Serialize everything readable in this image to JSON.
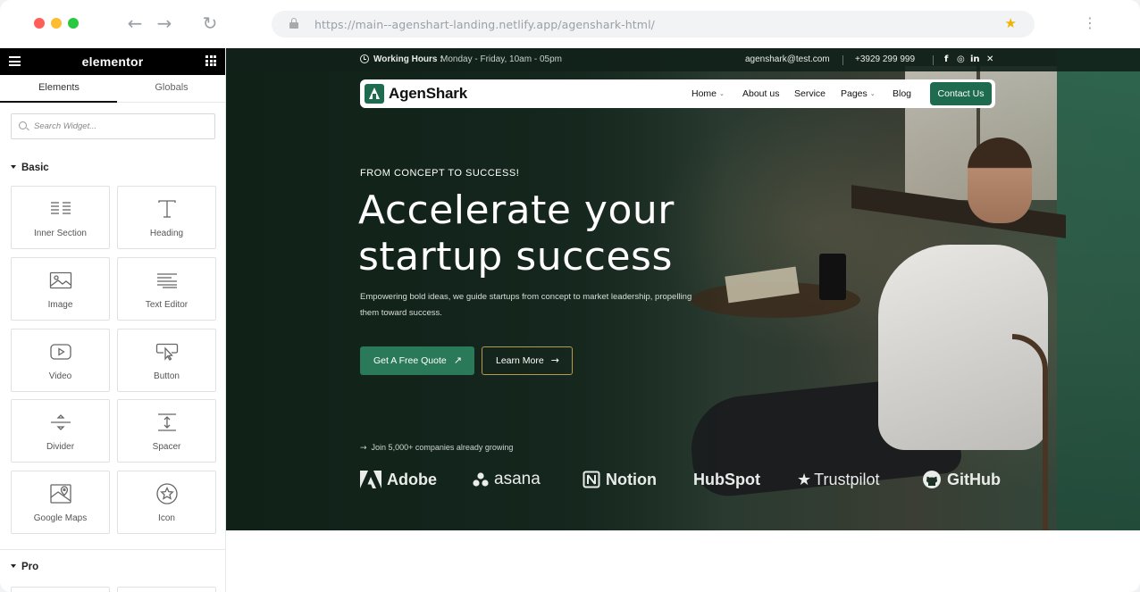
{
  "browser": {
    "url": "https://main--agenshart-landing.netlify.app/agenshark-html/",
    "icons": [
      "back-arrow-icon",
      "forward-arrow-icon",
      "reload-icon",
      "lock-icon",
      "bookmark-star-icon",
      "kebab-menu-icon"
    ]
  },
  "sidebar": {
    "logo": "elementor",
    "tabs": [
      {
        "label": "Elements"
      },
      {
        "label": "Globals"
      }
    ],
    "search_placeholder": "Search Widget...",
    "categories": [
      {
        "label": "Basic"
      },
      {
        "label": "Pro"
      }
    ],
    "widgets": [
      {
        "label": "Inner Section",
        "icon": "inner-section-icon"
      },
      {
        "label": "Heading",
        "icon": "heading-icon"
      },
      {
        "label": "Image",
        "icon": "image-icon"
      },
      {
        "label": "Text Editor",
        "icon": "text-editor-icon"
      },
      {
        "label": "Video",
        "icon": "video-icon"
      },
      {
        "label": "Button",
        "icon": "button-icon"
      },
      {
        "label": "Divider",
        "icon": "divider-icon"
      },
      {
        "label": "Spacer",
        "icon": "spacer-icon"
      },
      {
        "label": "Google Maps",
        "icon": "google-maps-icon"
      },
      {
        "label": "Icon",
        "icon": "icon-star-icon"
      }
    ]
  },
  "site": {
    "topbar": {
      "hours_label": "Working Hours :",
      "hours_value": "Monday - Friday, 10am - 05pm",
      "email": "agenshark@test.com",
      "phone": "+3929 299 999",
      "social": [
        "f",
        "◎",
        "in",
        "✕"
      ]
    },
    "nav": {
      "brand": "AgenShark",
      "items": [
        {
          "label": "Home",
          "has_dropdown": true
        },
        {
          "label": "About us",
          "has_dropdown": false
        },
        {
          "label": "Service",
          "has_dropdown": false
        },
        {
          "label": "Pages",
          "has_dropdown": true
        },
        {
          "label": "Blog",
          "has_dropdown": false
        }
      ],
      "cta": "Contact Us"
    },
    "hero": {
      "eyebrow": "FROM CONCEPT TO SUCCESS!",
      "title_line1": "Accelerate your",
      "title_line2": "startup success",
      "lede": "Empowering bold ideas, we guide startups from concept to market leadership, propelling them toward success.",
      "primary_cta": "Get A Free Quote",
      "secondary_cta": "Learn More",
      "trust_line": "Join 5,000+ companies already growing",
      "logos": [
        {
          "name": "Adobe",
          "icon": "adobe-logo-icon"
        },
        {
          "name": "asana",
          "icon": "asana-logo-icon"
        },
        {
          "name": "Notion",
          "icon": "notion-logo-icon"
        },
        {
          "name": "HubSpot",
          "icon": "hubspot-logo-icon"
        },
        {
          "name": "Trustpilot",
          "icon": "trustpilot-logo-icon"
        },
        {
          "name": "GitHub",
          "icon": "github-logo-icon"
        }
      ]
    },
    "colors": {
      "brand_green": "#1e6b4f",
      "button_green": "#2a7a5a",
      "outline_gold": "#b89b4a",
      "hero_dark": "#16291f"
    }
  }
}
